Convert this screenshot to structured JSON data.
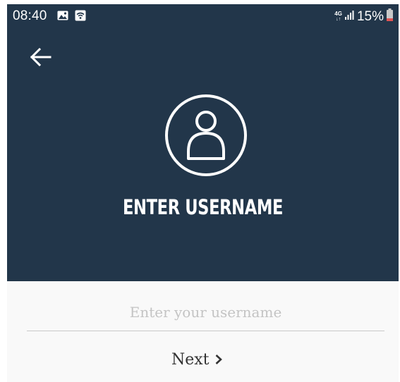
{
  "status_bar": {
    "time": "08:40",
    "network_type": "4G",
    "battery_percent": "15%",
    "icons": [
      "image-icon",
      "wifi-icon",
      "signal-icon",
      "battery-icon"
    ]
  },
  "header": {
    "background_color": "#22364a",
    "title": "ENTER USERNAME",
    "icons": [
      "back-arrow-icon",
      "user-avatar-icon"
    ]
  },
  "form": {
    "username_placeholder": "Enter your username",
    "username_value": "",
    "next_label": "Next",
    "next_icon": "chevron-right-icon"
  },
  "colors": {
    "header_bg": "#22364a",
    "page_bg": "#f9f9f9",
    "battery_low": "#e05353"
  }
}
